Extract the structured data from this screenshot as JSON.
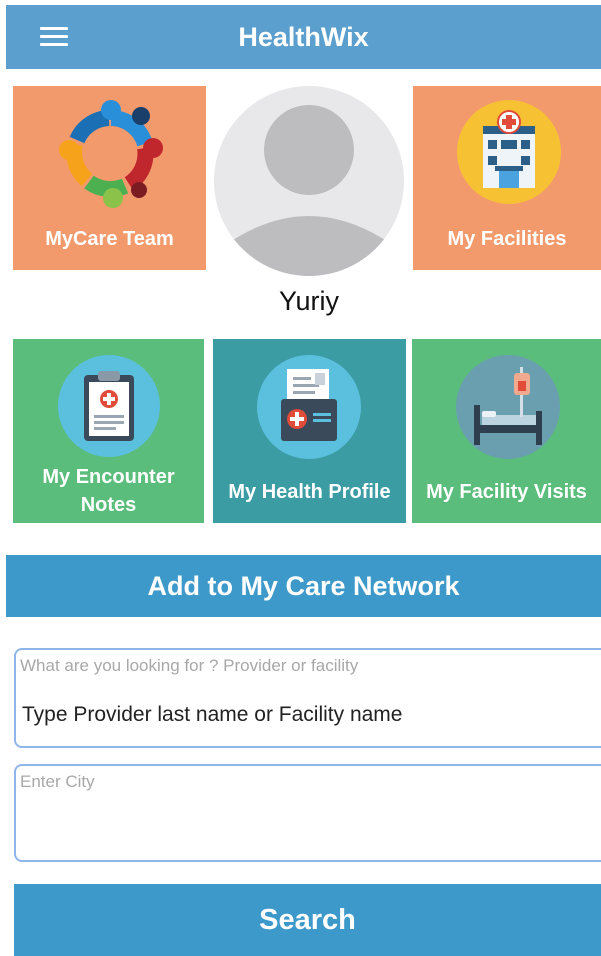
{
  "header": {
    "title": "HealthWix",
    "menu_icon": "hamburger-menu-icon"
  },
  "profile": {
    "username": "Yuriy",
    "avatar_icon": "user-silhouette-icon"
  },
  "tiles": {
    "mycare_team": {
      "label": "MyCare Team",
      "icon": "team-circle-icon",
      "color": "#f39a6d"
    },
    "my_facilities": {
      "label": "My Facilities",
      "icon": "hospital-building-icon",
      "color": "#f39a6d"
    },
    "encounter_notes": {
      "label_line1": "My Encounter",
      "label_line2": "Notes",
      "icon": "clipboard-medical-icon",
      "color": "#5bbd7b"
    },
    "health_profile": {
      "label": "My Health Profile",
      "icon": "medical-folder-icon",
      "color": "#3c9ca4"
    },
    "facility_visits": {
      "label": "My Facility Visits",
      "icon": "hospital-bed-icon",
      "color": "#5bbd7b"
    }
  },
  "network": {
    "title": "Add to My Care Network"
  },
  "search": {
    "type_placeholder_label": "What are you looking for ? Provider or facility",
    "type_value": "Type Provider last name or Facility name",
    "city_placeholder_label": "Enter City",
    "city_value": "",
    "button_label": "Search"
  },
  "colors": {
    "header_blue": "#5b9fce",
    "action_blue": "#3e99cb",
    "orange_tile": "#f39a6d",
    "green_tile": "#5bbd7b",
    "teal_tile": "#3c9ca4"
  }
}
